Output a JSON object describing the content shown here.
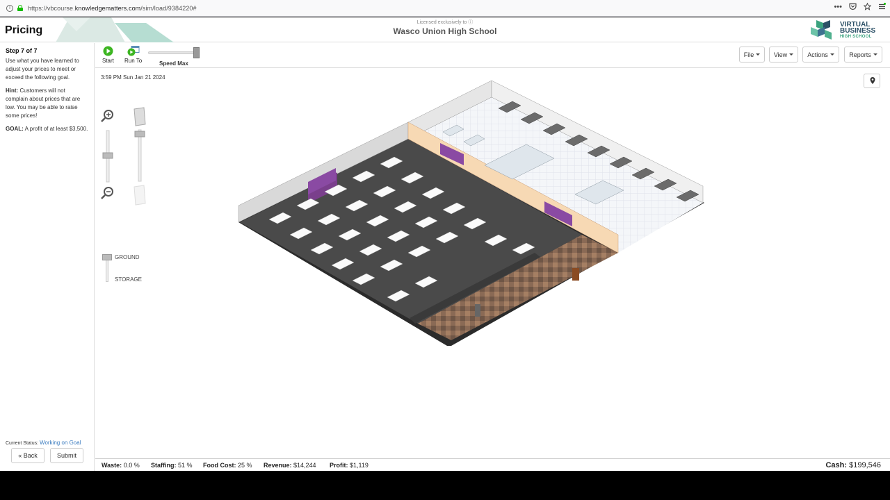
{
  "browser": {
    "url_prefix": "https://vbcourse.",
    "url_domain": "knowledgematters.com",
    "url_path": "/sim/load/9384220#",
    "menu_glyph": "•••"
  },
  "header": {
    "page_title": "Pricing",
    "license_text": "Licensed exclusively to",
    "school": "Wasco Union High School",
    "logo_line1": "VIRTUAL",
    "logo_line2": "BUSINESS",
    "logo_line3": "HIGH SCHOOL"
  },
  "sidebar": {
    "step": "Step 7 of 7",
    "instructions": "Use what you have learned to adjust your prices to meet or exceed the following goal.",
    "hint_label": "Hint:",
    "hint_text": " Customers will not complain about prices that are low. You may be able to raise some prices!",
    "goal_label": "GOAL:",
    "goal_text": " A profit of at least $3,500.",
    "status_label": "Current Status:",
    "status_value": "Working on Goal",
    "back_label": "Back",
    "submit_label": "Submit"
  },
  "toolbar": {
    "start_label": "Start",
    "runto_label": "Run To",
    "speed_label": "Speed Max",
    "speed_value": 1.0,
    "menus": [
      "File",
      "View",
      "Actions",
      "Reports"
    ]
  },
  "game": {
    "datetime": "3:59 PM Sun Jan 21 2024",
    "level_ground": "GROUND",
    "level_storage": "STORAGE"
  },
  "status": {
    "waste_label": "Waste:",
    "waste_value": "0.0 %",
    "staffing_label": "Staffing:",
    "staffing_value": "51 %",
    "foodcost_label": "Food Cost:",
    "foodcost_value": "25 %",
    "revenue_label": "Revenue:",
    "revenue_value": "$14,244",
    "profit_label": "Profit:",
    "profit_value": "$1,119",
    "cash_label": "Cash:",
    "cash_value": "$199,546"
  },
  "colors": {
    "accent_blue": "#3a7bbf",
    "start_green": "#3cb521",
    "logo_teal": "#3aa27e"
  }
}
